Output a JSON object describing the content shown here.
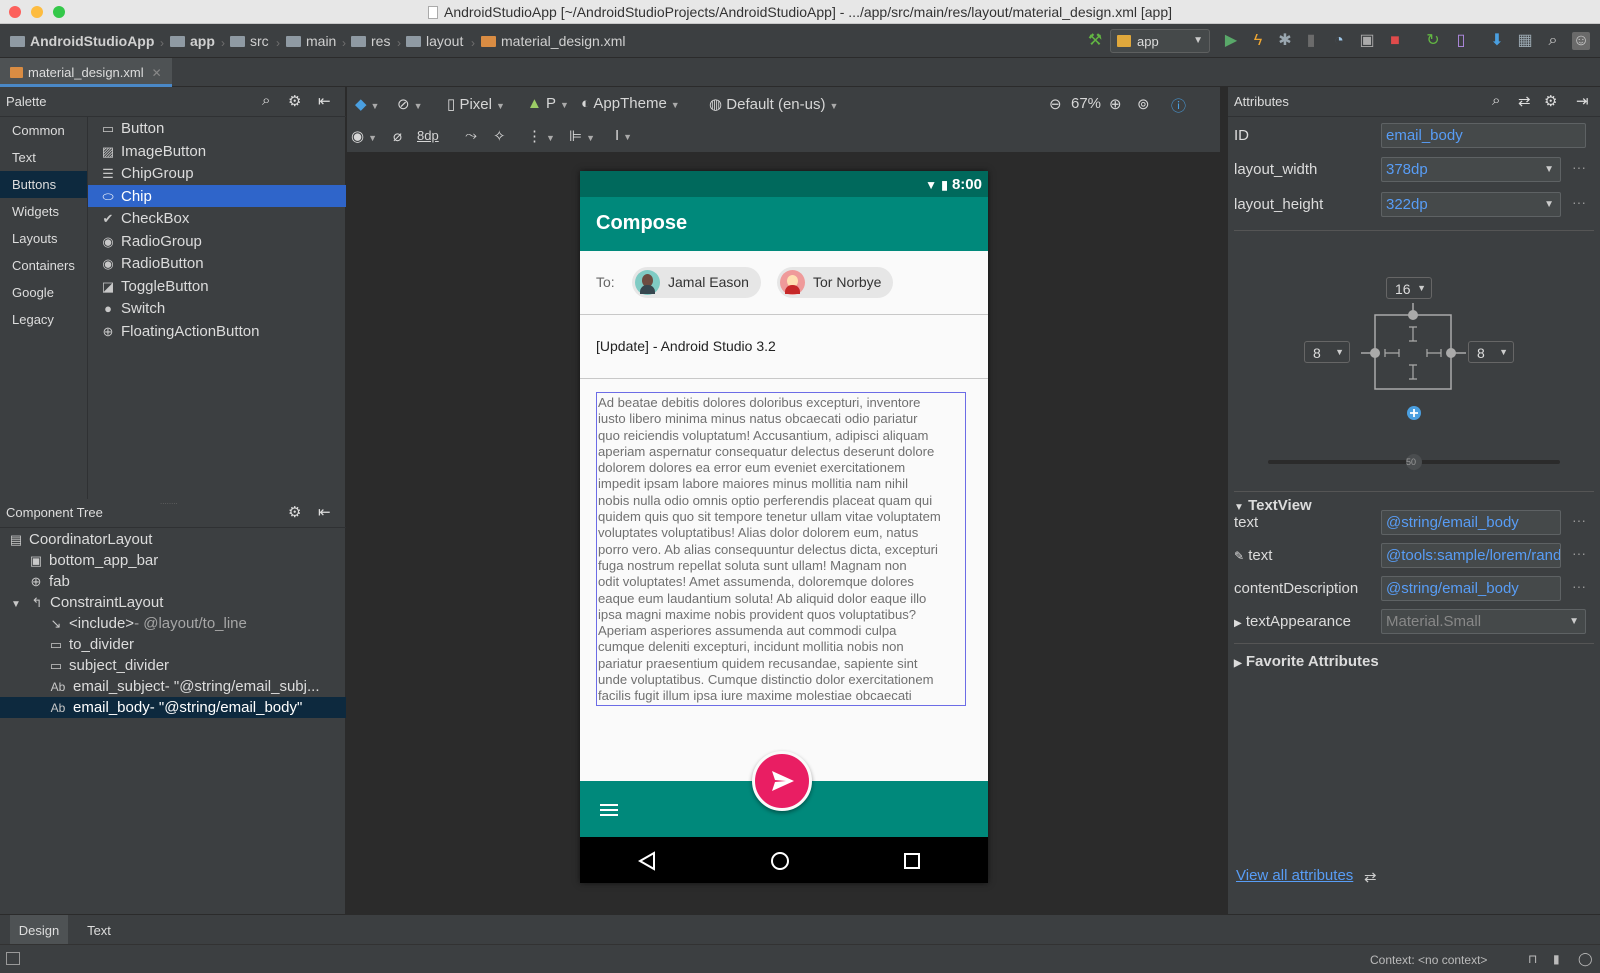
{
  "window": {
    "title": "AndroidStudioApp [~/AndroidStudioProjects/AndroidStudioApp] - .../app/src/main/res/layout/material_design.xml [app]"
  },
  "breadcrumbs": [
    "AndroidStudioApp",
    "app",
    "src",
    "main",
    "res",
    "layout",
    "material_design.xml"
  ],
  "toolbar": {
    "run_config": "app"
  },
  "editor_tab": {
    "label": "material_design.xml"
  },
  "palette": {
    "title": "Palette",
    "categories": [
      "Common",
      "Text",
      "Buttons",
      "Widgets",
      "Layouts",
      "Containers",
      "Google",
      "Legacy"
    ],
    "selected_category": "Buttons",
    "items": [
      {
        "label": "Button",
        "icon": "button-icon"
      },
      {
        "label": "ImageButton",
        "icon": "image-button-icon"
      },
      {
        "label": "ChipGroup",
        "icon": "chip-group-icon"
      },
      {
        "label": "Chip",
        "icon": "chip-icon"
      },
      {
        "label": "CheckBox",
        "icon": "checkbox-icon"
      },
      {
        "label": "RadioGroup",
        "icon": "radio-group-icon"
      },
      {
        "label": "RadioButton",
        "icon": "radio-button-icon"
      },
      {
        "label": "ToggleButton",
        "icon": "toggle-button-icon"
      },
      {
        "label": "Switch",
        "icon": "switch-icon"
      },
      {
        "label": "FloatingActionButton",
        "icon": "fab-icon"
      }
    ],
    "selected_item": "Chip"
  },
  "component_tree": {
    "title": "Component Tree",
    "nodes": [
      {
        "label": "CoordinatorLayout",
        "extra": ""
      },
      {
        "label": "bottom_app_bar",
        "extra": ""
      },
      {
        "label": "fab",
        "extra": ""
      },
      {
        "label": "ConstraintLayout",
        "extra": ""
      },
      {
        "label": "<include>",
        "extra": "- @layout/to_line"
      },
      {
        "label": "to_divider",
        "extra": ""
      },
      {
        "label": "subject_divider",
        "extra": ""
      },
      {
        "label": "email_subject",
        "extra": "- \"@string/email_subj..."
      },
      {
        "label": "email_body",
        "extra": "- \"@string/email_body\""
      }
    ]
  },
  "design_toolbar": {
    "device": "Pixel",
    "api": "P",
    "theme": "AppTheme",
    "locale": "Default (en-us)",
    "zoom": "67%",
    "margin": "8dp"
  },
  "preview": {
    "time": "8:00",
    "app_title": "Compose",
    "to_label": "To:",
    "chips": [
      "Jamal Eason",
      "Tor Norbye"
    ],
    "subject": "[Update] - Android Studio 3.2",
    "body_lines": [
      "Ad beatae debitis dolores doloribus excepturi, inventore",
      "iusto libero minima minus natus obcaecati odio pariatur",
      "quo reiciendis voluptatum! Accusantium, adipisci aliquam",
      "aperiam aspernatur consequatur delectus deserunt dolore",
      "dolorem dolores ea error eum eveniet exercitationem",
      "impedit ipsam labore maiores minus mollitia nam nihil",
      "nobis nulla odio omnis optio perferendis placeat quam qui",
      "quidem quis quo sit tempore tenetur ullam vitae voluptatem",
      "voluptates voluptatibus! Alias dolor dolorem eum, natus",
      "porro vero. Ab alias consequuntur delectus dicta, excepturi",
      "fuga nostrum repellat soluta sunt ullam! Magnam non",
      "odit voluptates! Amet assumenda, doloremque dolores",
      "eaque eum laudantium soluta! Ab aliquid dolor eaque illo",
      "ipsa magni maxime nobis provident quos voluptatibus?",
      "Aperiam asperiores assumenda aut commodi culpa",
      "cumque deleniti excepturi, incidunt mollitia nobis non",
      "pariatur praesentium quidem recusandae, sapiente sint",
      "unde voluptatibus. Cumque distinctio dolor exercitationem",
      "facilis fugit illum ipsa iure maxime molestiae obcaecati"
    ]
  },
  "attributes": {
    "title": "Attributes",
    "id_label": "ID",
    "id_value": "email_body",
    "layout_width_label": "layout_width",
    "layout_width_value": "378dp",
    "layout_height_label": "layout_height",
    "layout_height_value": "322dp",
    "constraint_top": "16",
    "constraint_left": "8",
    "constraint_right": "8",
    "bias": "50",
    "section_textview": "TextView",
    "text_label": "text",
    "text_value": "@string/email_body",
    "tools_text_label": "text",
    "tools_text_value": "@tools:sample/lorem/random",
    "content_desc_label": "contentDescription",
    "content_desc_value": "@string/email_body",
    "text_appearance_label": "textAppearance",
    "text_appearance_value": "Material.Small",
    "section_favorites": "Favorite Attributes",
    "view_all": "View all attributes"
  },
  "bottom_tabs": [
    "Design",
    "Text"
  ],
  "statusbar": {
    "context": "Context: <no context>"
  },
  "colors": {
    "accent": "#2f65ca",
    "teal": "#00897b",
    "teal_dark": "#00695c",
    "fab": "#e91e63",
    "link": "#589df6"
  }
}
